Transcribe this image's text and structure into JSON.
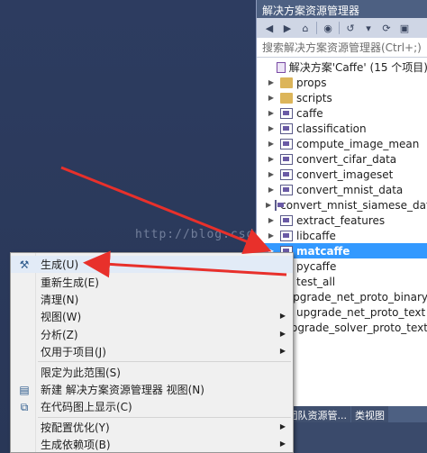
{
  "panel": {
    "title": "解决方案资源管理器",
    "search_placeholder": "搜索解决方案资源管理器(Ctrl+;)",
    "toolbar_icons": [
      "back-icon",
      "forward-icon",
      "home-icon",
      "vs-icon",
      "history-icon",
      "dropdown-icon",
      "refresh-icon",
      "collapse-icon"
    ]
  },
  "tree": {
    "solution": "解决方案'Caffe' (15 个项目)",
    "items": [
      {
        "label": "props",
        "kind": "folder"
      },
      {
        "label": "scripts",
        "kind": "folder"
      },
      {
        "label": "caffe",
        "kind": "project"
      },
      {
        "label": "classification",
        "kind": "project"
      },
      {
        "label": "compute_image_mean",
        "kind": "project"
      },
      {
        "label": "convert_cifar_data",
        "kind": "project"
      },
      {
        "label": "convert_imageset",
        "kind": "project"
      },
      {
        "label": "convert_mnist_data",
        "kind": "project"
      },
      {
        "label": "convert_mnist_siamese_data",
        "kind": "project"
      },
      {
        "label": "extract_features",
        "kind": "project"
      },
      {
        "label": "libcaffe",
        "kind": "project"
      },
      {
        "label": "matcaffe",
        "kind": "project",
        "selected": true
      },
      {
        "label": "pycaffe",
        "kind": "project"
      },
      {
        "label": "test_all",
        "kind": "project"
      },
      {
        "label": "upgrade_net_proto_binary",
        "kind": "project"
      },
      {
        "label": "upgrade_net_proto_text",
        "kind": "project"
      },
      {
        "label": "upgrade_solver_proto_text",
        "kind": "project"
      }
    ]
  },
  "bottom_tabs": [
    "案...",
    "团队资源管...",
    "类视图"
  ],
  "watermark": "http://blog.csdn",
  "menu": {
    "items": [
      {
        "label": "生成(U)",
        "icon": "build-icon"
      },
      {
        "label": "重新生成(E)"
      },
      {
        "label": "清理(N)"
      },
      {
        "label": "视图(W)",
        "submenu": true
      },
      {
        "label": "分析(Z)",
        "submenu": true
      },
      {
        "label": "仅用于项目(J)",
        "submenu": true
      },
      {
        "sep": true
      },
      {
        "label": "限定为此范围(S)"
      },
      {
        "label": "新建 解决方案资源管理器 视图(N)",
        "icon": "new-view-icon"
      },
      {
        "label": "在代码图上显示(C)",
        "icon": "code-map-icon"
      },
      {
        "sep": true
      },
      {
        "label": "按配置优化(Y)",
        "submenu": true
      },
      {
        "label": "生成依赖项(B)",
        "submenu": true
      }
    ]
  },
  "colors": {
    "selection": "#3399ff",
    "arrow": "#e8302b",
    "panel_title": "#4d6082"
  }
}
